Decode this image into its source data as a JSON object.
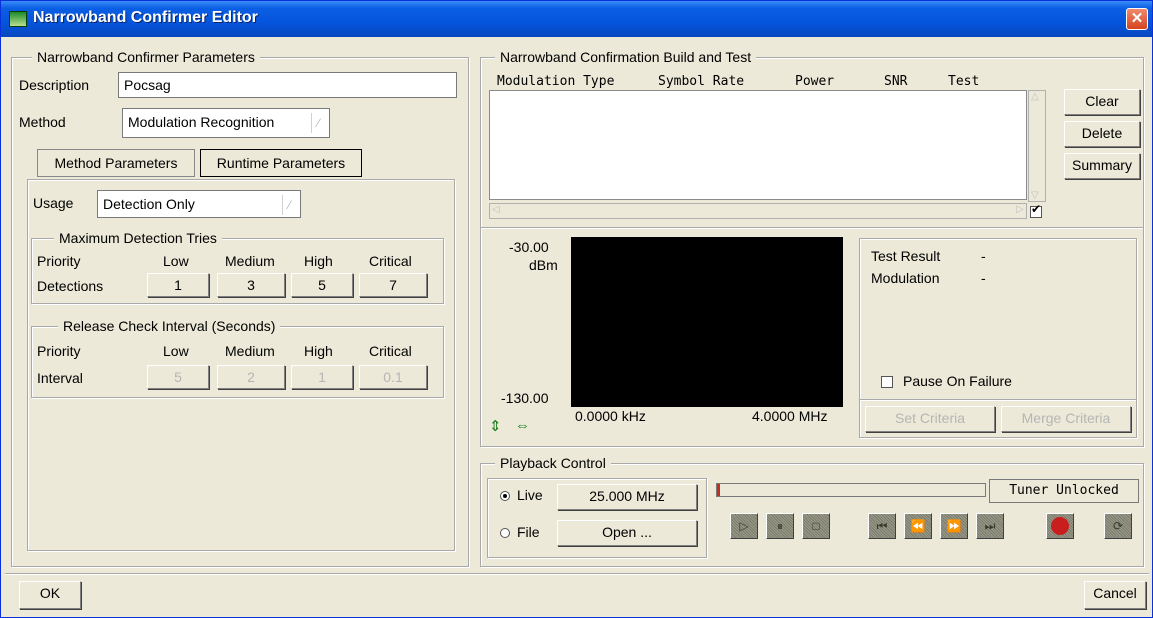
{
  "window": {
    "title": "Narrowband Confirmer Editor",
    "close_glyph": "✕"
  },
  "params": {
    "legend": "Narrowband Confirmer Parameters",
    "description_label": "Description",
    "description_value": "Pocsag",
    "method_label": "Method",
    "method_value": "Modulation Recognition",
    "tabs": {
      "method": "Method Parameters",
      "runtime": "Runtime Parameters"
    },
    "usage_label": "Usage",
    "usage_value": "Detection Only",
    "max_detection": {
      "legend": "Maximum Detection Tries",
      "priority_label": "Priority",
      "row_label": "Detections",
      "columns": [
        "Low",
        "Medium",
        "High",
        "Critical"
      ],
      "values": [
        "1",
        "3",
        "5",
        "7"
      ]
    },
    "release_check": {
      "legend": "Release Check Interval (Seconds)",
      "priority_label": "Priority",
      "row_label": "Interval",
      "columns": [
        "Low",
        "Medium",
        "High",
        "Critical"
      ],
      "values": [
        "5",
        "2",
        "1",
        "0.1"
      ]
    }
  },
  "build_test": {
    "legend": "Narrowband Confirmation Build and Test",
    "columns": [
      "Modulation Type",
      "Symbol Rate",
      "Power",
      "SNR",
      "Test"
    ],
    "buttons": {
      "clear": "Clear",
      "delete": "Delete",
      "summary": "Summary"
    },
    "plot": {
      "y_top": "-30.00",
      "y_unit": "dBm",
      "y_bottom": "-130.00",
      "x_left": "0.0000 kHz",
      "x_right": "4.0000 MHz"
    },
    "result": {
      "test_result_label": "Test Result",
      "test_result_value": "-",
      "modulation_label": "Modulation",
      "modulation_value": "-",
      "pause_label": "Pause On Failure",
      "set_criteria": "Set Criteria",
      "merge_criteria": "Merge Criteria"
    }
  },
  "playback": {
    "legend": "Playback Control",
    "live_label": "Live",
    "live_value": "25.000 MHz",
    "file_label": "File",
    "file_value": "Open ...",
    "tuner_status": "Tuner Unlocked",
    "progress": 0.01,
    "record_color": "#c81e1e"
  },
  "footer": {
    "ok": "OK",
    "cancel": "Cancel"
  }
}
